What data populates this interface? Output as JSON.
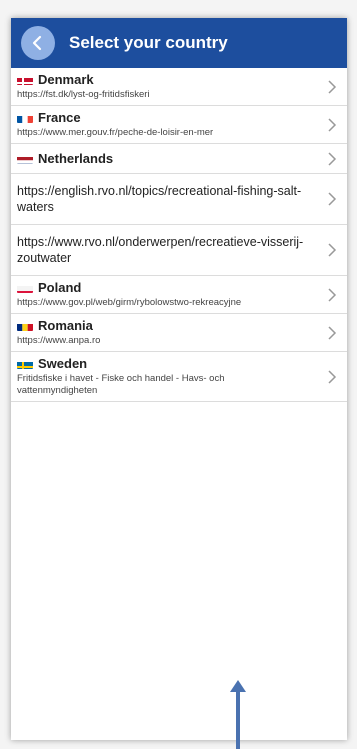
{
  "header": {
    "title": "Select your country",
    "color": "#1d4e9e"
  },
  "rows": [
    {
      "type": "country",
      "name": "Denmark",
      "url": "https://fst.dk/lyst-og-fritidsfiskeri",
      "flag": "dk"
    },
    {
      "type": "country",
      "name": "France",
      "url": "https://www.mer.gouv.fr/peche-de-loisir-en-mer",
      "flag": "fr"
    },
    {
      "type": "country",
      "name": "Netherlands",
      "flag": "nl"
    },
    {
      "type": "link",
      "url": "https://english.rvo.nl/topics/recreational-fishing-salt-waters"
    },
    {
      "type": "link",
      "url": "https://www.rvo.nl/onderwerpen/recreatieve-visserij-zoutwater"
    },
    {
      "type": "country",
      "name": "Poland",
      "url": "https://www.gov.pl/web/girm/rybolowstwo-rekreacyjne",
      "flag": "pl"
    },
    {
      "type": "country",
      "name": "Romania",
      "url": "https://www.anpa.ro",
      "flag": "ro"
    },
    {
      "type": "country",
      "name": "Sweden",
      "url": "Fritidsfiske i havet - Fiske och handel - Havs- och vattenmyndigheten",
      "flag": "se"
    }
  ],
  "icons": {
    "back": "chevron-left-icon",
    "row": "chevron-right-icon",
    "overlay": "arrow-up-icon"
  },
  "colors": {
    "overlay_arrow": "#4a72b0",
    "back_circle": "#8fb0e4"
  }
}
